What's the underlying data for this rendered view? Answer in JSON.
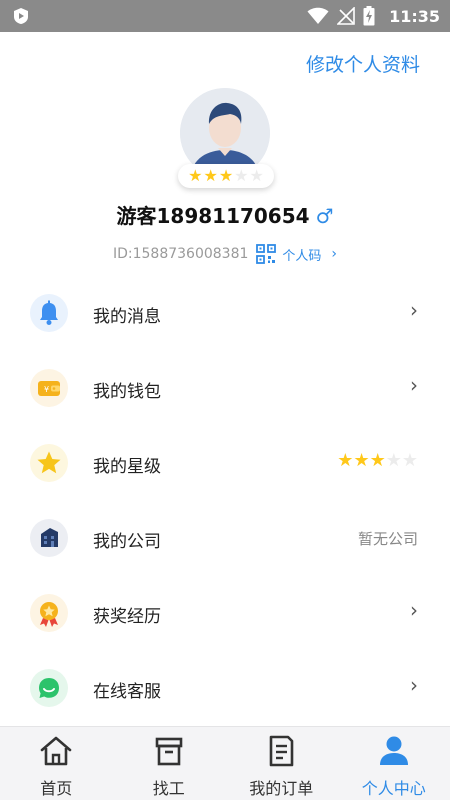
{
  "status_bar": {
    "time": "11:35",
    "icons": [
      "play-shield-icon",
      "wifi-icon",
      "signal-off-icon",
      "battery-charging-icon"
    ]
  },
  "header": {
    "edit_profile": "修改个人资料"
  },
  "profile": {
    "stars_filled": 3,
    "stars_total": 5,
    "username": "游客18981170654",
    "gender_symbol": "♂",
    "id_text": "ID:1588736008381",
    "qr_label": "个人码",
    "qr_chevron": "›"
  },
  "menu": {
    "items": [
      {
        "label": "我的消息",
        "icon": "bell-icon",
        "accent": "#3d8ff0",
        "bg": "#e9f2fd",
        "arrow": "›"
      },
      {
        "label": "我的钱包",
        "icon": "wallet-icon",
        "accent": "#f5b21c",
        "bg": "#fdf4e3",
        "arrow": "›"
      },
      {
        "label": "我的星级",
        "icon": "star-icon",
        "accent": "#f7c51a",
        "bg": "#fdf7df",
        "stars_filled": 3,
        "stars_total": 5
      },
      {
        "label": "我的公司",
        "icon": "building-icon",
        "accent": "#243a66",
        "bg": "#eceef3",
        "value": "暂无公司"
      },
      {
        "label": "获奖经历",
        "icon": "medal-icon",
        "accent": "#f5b21c",
        "bg": "#fdf4e3",
        "arrow": "›"
      },
      {
        "label": "在线客服",
        "icon": "chat-icon",
        "accent": "#2cc36b",
        "bg": "#e5f7ec",
        "arrow": "›"
      }
    ]
  },
  "tabs": {
    "items": [
      {
        "label": "首页",
        "icon": "home-icon"
      },
      {
        "label": "找工",
        "icon": "box-icon"
      },
      {
        "label": "我的订单",
        "icon": "document-icon"
      },
      {
        "label": "个人中心",
        "icon": "person-icon",
        "active": true
      }
    ],
    "active_color": "#2f8be6"
  }
}
